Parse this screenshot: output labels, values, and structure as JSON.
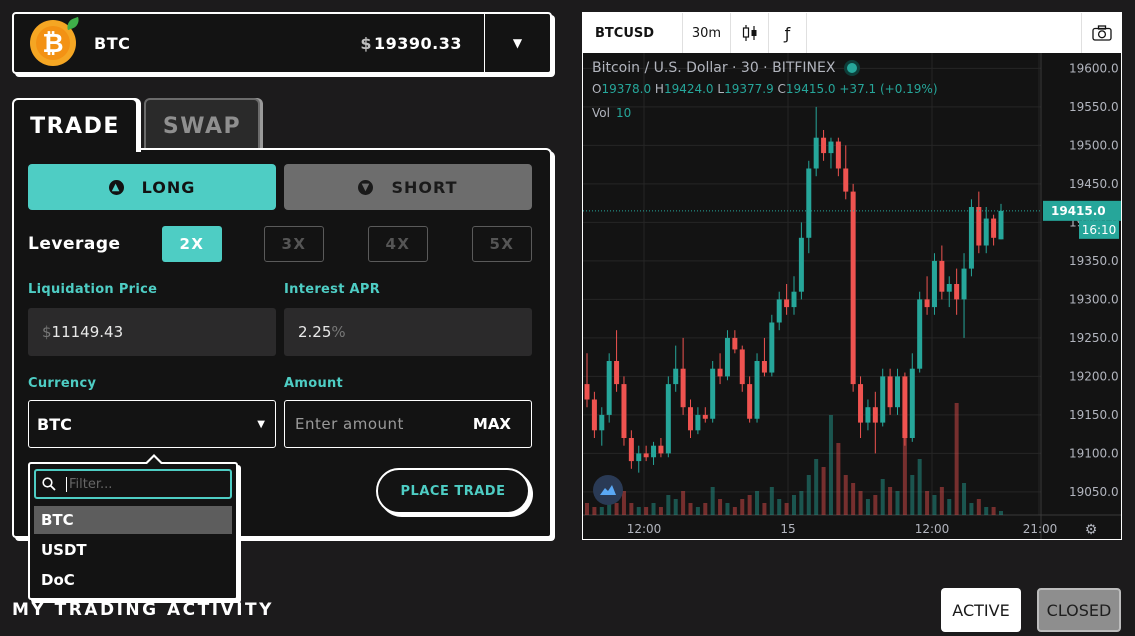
{
  "asset_bar": {
    "symbol": "BTC",
    "currency_symbol": "$",
    "price": "19390.33",
    "coin_glyph": "₿",
    "coin_color": "#f5a623"
  },
  "tabs": [
    {
      "label": "TRADE",
      "active": true
    },
    {
      "label": "SWAP",
      "active": false
    }
  ],
  "trade": {
    "long_label": "LONG",
    "short_label": "SHORT",
    "leverage_label": "Leverage",
    "leverage_options": [
      "2X",
      "3X",
      "4X",
      "5X"
    ],
    "leverage_selected": "2X",
    "liquidation_label": "Liquidation Price",
    "liquidation_currency": "$",
    "liquidation_value": "11149.43",
    "interest_label": "Interest APR",
    "interest_value": "2.25",
    "interest_unit": "%",
    "currency_label": "Currency",
    "currency_value": "BTC",
    "amount_label": "Amount",
    "amount_placeholder": "Enter amount",
    "max_label": "MAX",
    "place_trade_label": "PLACE TRADE"
  },
  "currency_dropdown": {
    "filter_placeholder": "Filter...",
    "options": [
      "BTC",
      "USDT",
      "DoC"
    ],
    "selected": "BTC"
  },
  "activity": {
    "title": "MY TRADING ACTIVITY",
    "active_label": "ACTIVE",
    "closed_label": "CLOSED"
  },
  "chart_toolbar": {
    "symbol": "BTCUSD",
    "interval": "30m",
    "candle_icon": "candlestick-icon",
    "fx_icon": "fx-icon",
    "fx_glyph": "ƒ",
    "camera_icon": "camera-icon"
  },
  "chart_header": {
    "title": "Bitcoin / U.S. Dollar · 30 · BITFINEX",
    "o_label": "O",
    "o": "19378.0",
    "h_label": "H",
    "h": "19424.0",
    "l_label": "L",
    "l": "19377.9",
    "c_label": "C",
    "c": "19415.0",
    "change": "+37.1 (+0.19%)",
    "vol_label": "Vol",
    "vol": "10"
  },
  "chart_data": {
    "type": "candlestick",
    "title": "Bitcoin / U.S. Dollar · 30 · BITFINEX",
    "x_tick_labels": [
      "12:00",
      "15",
      "12:00",
      "21:00"
    ],
    "y_tick_labels": [
      "19600.0",
      "19550.0",
      "19500.0",
      "19450.0",
      "19400.0",
      "19350.0",
      "19300.0",
      "19250.0",
      "19200.0",
      "19150.0",
      "19100.0",
      "19050.0"
    ],
    "ylim": [
      19020,
      19620
    ],
    "last_price_label": "19415.0",
    "countdown_label": "16:10",
    "up_color": "#26a69a",
    "down_color": "#ef5350",
    "grid": true,
    "candles": [
      [
        19190,
        19230,
        19160,
        19170
      ],
      [
        19170,
        19180,
        19120,
        19130
      ],
      [
        19130,
        19160,
        19110,
        19150
      ],
      [
        19150,
        19230,
        19140,
        19220
      ],
      [
        19220,
        19260,
        19180,
        19190
      ],
      [
        19190,
        19200,
        19110,
        19120
      ],
      [
        19120,
        19130,
        19080,
        19090
      ],
      [
        19090,
        19110,
        19075,
        19100
      ],
      [
        19100,
        19110,
        19090,
        19095
      ],
      [
        19095,
        19115,
        19085,
        19110
      ],
      [
        19110,
        19120,
        19095,
        19100
      ],
      [
        19100,
        19200,
        19095,
        19190
      ],
      [
        19190,
        19240,
        19180,
        19210
      ],
      [
        19210,
        19250,
        19150,
        19160
      ],
      [
        19160,
        19170,
        19120,
        19130
      ],
      [
        19130,
        19160,
        19125,
        19150
      ],
      [
        19150,
        19160,
        19140,
        19145
      ],
      [
        19145,
        19220,
        19140,
        19210
      ],
      [
        19210,
        19230,
        19190,
        19200
      ],
      [
        19200,
        19260,
        19195,
        19250
      ],
      [
        19250,
        19260,
        19230,
        19235
      ],
      [
        19235,
        19240,
        19180,
        19190
      ],
      [
        19190,
        19200,
        19140,
        19145
      ],
      [
        19145,
        19230,
        19140,
        19220
      ],
      [
        19220,
        19250,
        19200,
        19205
      ],
      [
        19205,
        19280,
        19200,
        19270
      ],
      [
        19270,
        19310,
        19260,
        19300
      ],
      [
        19300,
        19320,
        19280,
        19290
      ],
      [
        19290,
        19330,
        19280,
        19310
      ],
      [
        19310,
        19400,
        19300,
        19380
      ],
      [
        19380,
        19480,
        19360,
        19470
      ],
      [
        19470,
        19550,
        19460,
        19510
      ],
      [
        19510,
        19520,
        19480,
        19490
      ],
      [
        19490,
        19510,
        19470,
        19505
      ],
      [
        19505,
        19510,
        19460,
        19470
      ],
      [
        19470,
        19500,
        19430,
        19440
      ],
      [
        19440,
        19450,
        19180,
        19190
      ],
      [
        19190,
        19200,
        19120,
        19140
      ],
      [
        19140,
        19170,
        19130,
        19160
      ],
      [
        19160,
        19180,
        19100,
        19140
      ],
      [
        19140,
        19210,
        19135,
        19200
      ],
      [
        19200,
        19210,
        19150,
        19160
      ],
      [
        19160,
        19210,
        19150,
        19200
      ],
      [
        19200,
        19205,
        19110,
        19120
      ],
      [
        19120,
        19230,
        19115,
        19210
      ],
      [
        19210,
        19310,
        19205,
        19300
      ],
      [
        19300,
        19330,
        19280,
        19290
      ],
      [
        19290,
        19360,
        19280,
        19350
      ],
      [
        19350,
        19370,
        19300,
        19310
      ],
      [
        19310,
        19330,
        19290,
        19320
      ],
      [
        19320,
        19340,
        19280,
        19300
      ],
      [
        19300,
        19360,
        19250,
        19340
      ],
      [
        19340,
        19430,
        19330,
        19420
      ],
      [
        19420,
        19440,
        19360,
        19370
      ],
      [
        19370,
        19420,
        19360,
        19405
      ],
      [
        19405,
        19410,
        19370,
        19380
      ],
      [
        19378,
        19424,
        19377.9,
        19415
      ]
    ],
    "volumes": [
      3,
      2,
      2,
      4,
      3,
      6,
      3,
      2,
      2,
      3,
      2,
      5,
      4,
      6,
      3,
      2,
      3,
      7,
      4,
      3,
      2,
      4,
      5,
      6,
      3,
      7,
      4,
      3,
      5,
      6,
      10,
      14,
      12,
      25,
      18,
      10,
      8,
      6,
      4,
      5,
      9,
      7,
      6,
      22,
      10,
      14,
      6,
      5,
      7,
      4,
      28,
      8,
      3,
      4,
      2,
      2,
      1
    ]
  }
}
